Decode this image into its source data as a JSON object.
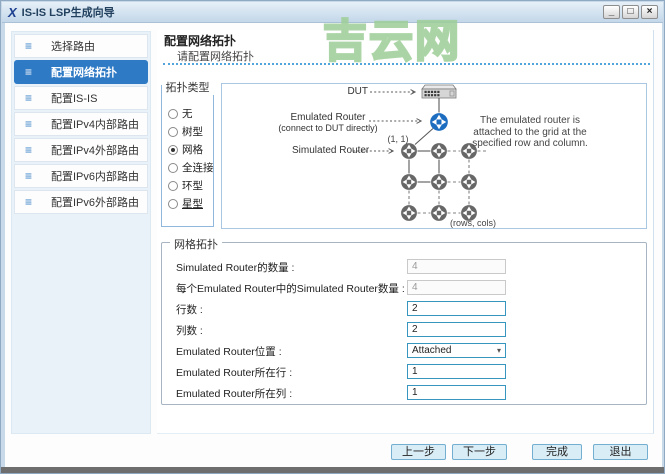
{
  "window": {
    "title": "IS-IS LSP生成向导",
    "watermark": "吉云网",
    "icons": {
      "logo": "X",
      "minimize": "_",
      "maximize": "□",
      "close": "×",
      "menu": "≡",
      "dropdown": "▾"
    }
  },
  "sidebar": {
    "items": [
      {
        "label": "选择路由",
        "active": false
      },
      {
        "label": "配置网络拓扑",
        "active": true
      },
      {
        "label": "配置IS-IS",
        "active": false
      },
      {
        "label": "配置IPv4内部路由",
        "active": false
      },
      {
        "label": "配置IPv4外部路由",
        "active": false
      },
      {
        "label": "配置IPv6内部路由",
        "active": false
      },
      {
        "label": "配置IPv6外部路由",
        "active": false
      }
    ]
  },
  "header": {
    "title": "配置网络拓扑",
    "subtitle": "请配置网络拓扑"
  },
  "topology_type": {
    "legend": "拓扑类型",
    "options": [
      {
        "label": "无",
        "selected": false
      },
      {
        "label": "树型",
        "selected": false
      },
      {
        "label": "网格",
        "selected": true
      },
      {
        "label": "全连接",
        "selected": false
      },
      {
        "label": "环型",
        "selected": false
      },
      {
        "label": "星型",
        "selected": false
      }
    ]
  },
  "diagram": {
    "dut_label": "DUT",
    "emulated_router_label": "Emulated Router",
    "emulated_router_sub": "(connect to DUT directly)",
    "simulated_router_label": "Simulated Router",
    "origin_label": "(1, 1)",
    "dims_label": "(rows, cols)",
    "note_line1": "The emulated router is",
    "note_line2": "attached to the grid at the",
    "note_line3": "specified row and column."
  },
  "grid_form": {
    "legend": "网格拓扑",
    "fields": [
      {
        "label": "Simulated Router的数量 :",
        "value": "4",
        "state": "disabled"
      },
      {
        "label": "每个Emulated Router中的Simulated Router数量 :",
        "value": "4",
        "state": "disabled"
      },
      {
        "label": "行数 :",
        "value": "2",
        "state": "editable"
      },
      {
        "label": "列数 :",
        "value": "2",
        "state": "editable"
      },
      {
        "label": "Emulated Router位置 :",
        "value": "Attached",
        "state": "dropdown"
      },
      {
        "label": "Emulated Router所在行 :",
        "value": "1",
        "state": "editable"
      },
      {
        "label": "Emulated Router所在列 :",
        "value": "1",
        "state": "editable"
      }
    ]
  },
  "footer": {
    "prev": "上一步",
    "next": "下一步",
    "finish": "完成",
    "exit": "退出"
  },
  "colors": {
    "accent": "#2f7ac5",
    "input_border": "#3696be",
    "button_bg": "#d9edf7",
    "watermark": "#9ece98"
  }
}
